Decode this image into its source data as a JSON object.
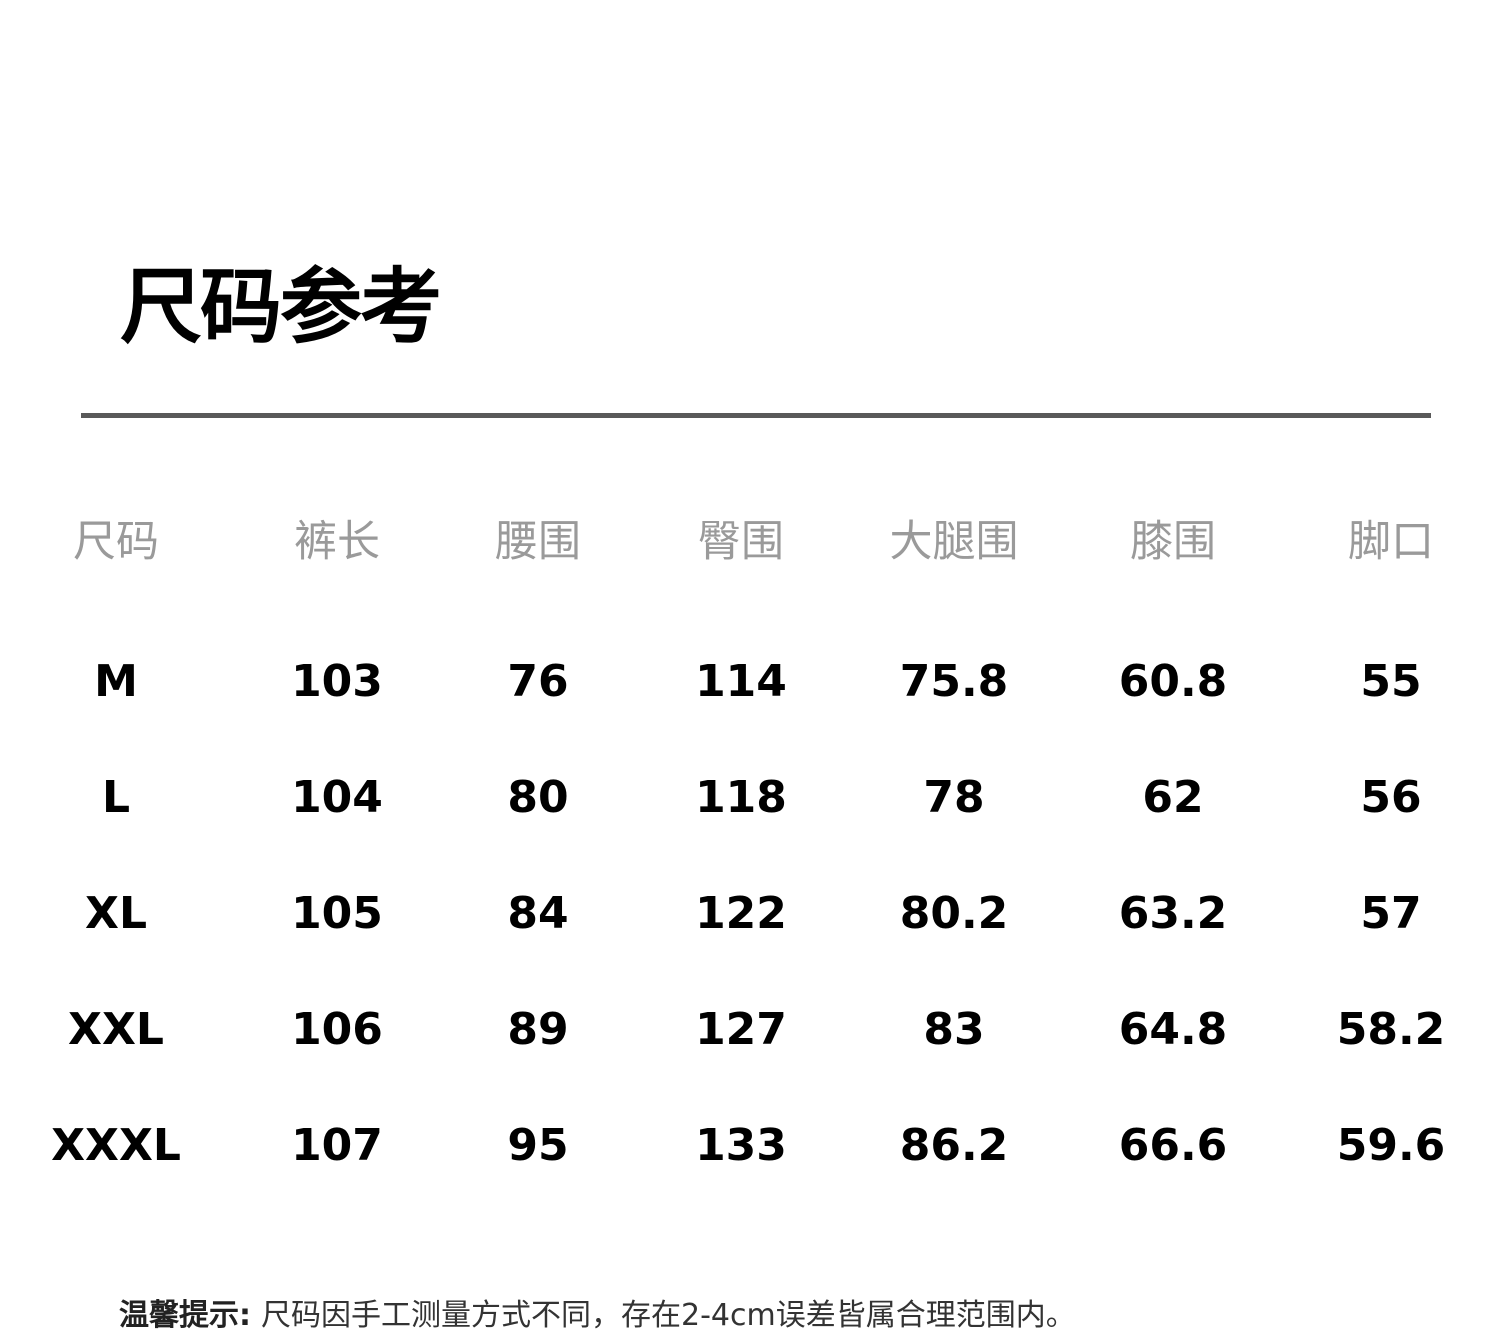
{
  "title": "尺码参考",
  "table": {
    "headers": [
      "尺码",
      "裤长",
      "腰围",
      "臀围",
      "大腿围",
      "膝围",
      "脚口"
    ],
    "rows": [
      [
        "M",
        "103",
        "76",
        "114",
        "75.8",
        "60.8",
        "55"
      ],
      [
        "L",
        "104",
        "80",
        "118",
        "78",
        "62",
        "56"
      ],
      [
        "XL",
        "105",
        "84",
        "122",
        "80.2",
        "63.2",
        "57"
      ],
      [
        "XXL",
        "106",
        "89",
        "127",
        "83",
        "64.8",
        "58.2"
      ],
      [
        "XXXL",
        "107",
        "95",
        "133",
        "86.2",
        "66.6",
        "59.6"
      ]
    ]
  },
  "footnote": {
    "label": "温馨提示:",
    "text": "尺码因手工测量方式不同，存在2-4cm误差皆属合理范围内。"
  },
  "colors": {
    "header_text": "#9a9a9a",
    "divider": "#595959",
    "body_text": "#000000"
  }
}
